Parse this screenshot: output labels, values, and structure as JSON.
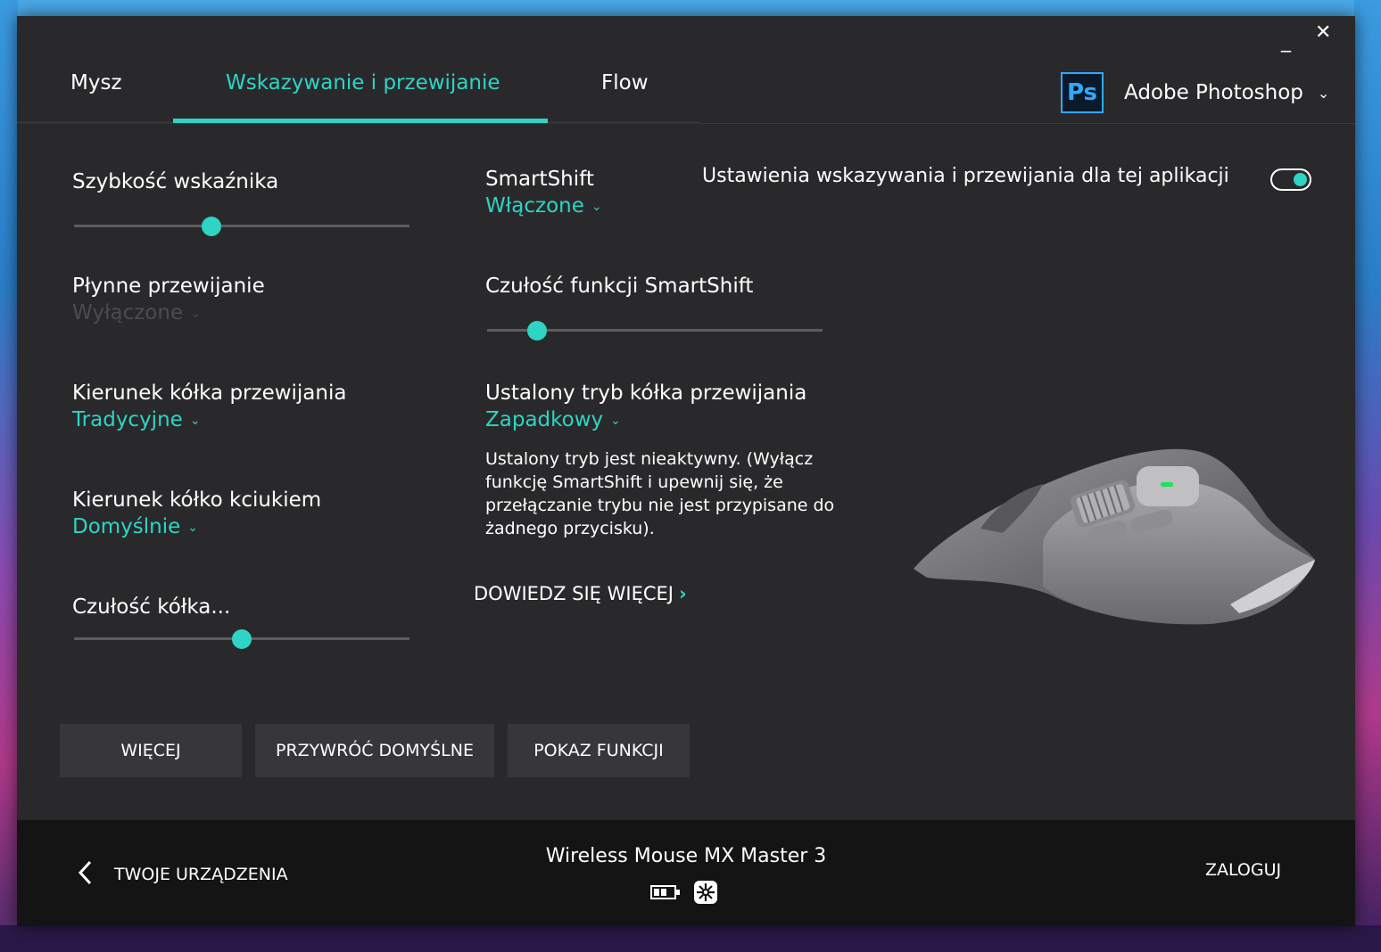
{
  "window": {
    "minimize": "_",
    "close": "✕"
  },
  "tabs": [
    {
      "label": "Mysz"
    },
    {
      "label": "Wskazywanie i przewijanie"
    },
    {
      "label": "Flow"
    }
  ],
  "app_selector": {
    "icon_text": "Ps",
    "name": "Adobe Photoshop"
  },
  "settings": {
    "pointer_speed": {
      "label": "Szybkość wskaźnika",
      "level": 0.41
    },
    "smooth_scroll": {
      "label": "Płynne przewijanie",
      "value": "Wyłączone"
    },
    "scroll_direction": {
      "label": "Kierunek kółka przewijania",
      "value": "Tradycyjne"
    },
    "thumb_direction": {
      "label": "Kierunek kółko kciukiem",
      "value": "Domyślnie"
    },
    "wheel_sensitivity": {
      "label": "Czułość kółka...",
      "level": 0.5
    },
    "smartshift": {
      "label": "SmartShift",
      "value": "Włączone"
    },
    "smartshift_sensitivity": {
      "label": "Czułość funkcji SmartShift",
      "level": 0.15
    },
    "fixed_mode": {
      "label": "Ustalony tryb kółka przewijania",
      "value": "Zapadkowy"
    },
    "app_specific": {
      "label": "Ustawienia wskazywania i przewijania dla tej aplikacji",
      "enabled": true
    }
  },
  "note": "Ustalony tryb jest nieaktywny. (Wyłącz funkcję SmartShift i upewnij się, że przełączanie trybu nie jest przypisane do żadnego przycisku).",
  "learn_more": "DOWIEDZ SIĘ WIĘCEJ",
  "buttons": {
    "more": "WIĘCEJ",
    "restore": "PRZYWRÓĆ DOMYŚLNE",
    "tour": "POKAZ FUNKCJI"
  },
  "footer": {
    "back_label": "TWOJE URZĄDZENIA",
    "device_name": "Wireless Mouse MX Master 3",
    "login": "ZALOGUJ"
  },
  "colors": {
    "accent": "#2fd4c4",
    "background": "#29292b",
    "footer": "#141415",
    "ps_blue": "#31a8ff"
  },
  "icons": [
    "chevron-down-icon",
    "chevron-left-icon",
    "chevron-right-icon",
    "battery-icon",
    "receiver-icon",
    "photoshop-icon"
  ]
}
